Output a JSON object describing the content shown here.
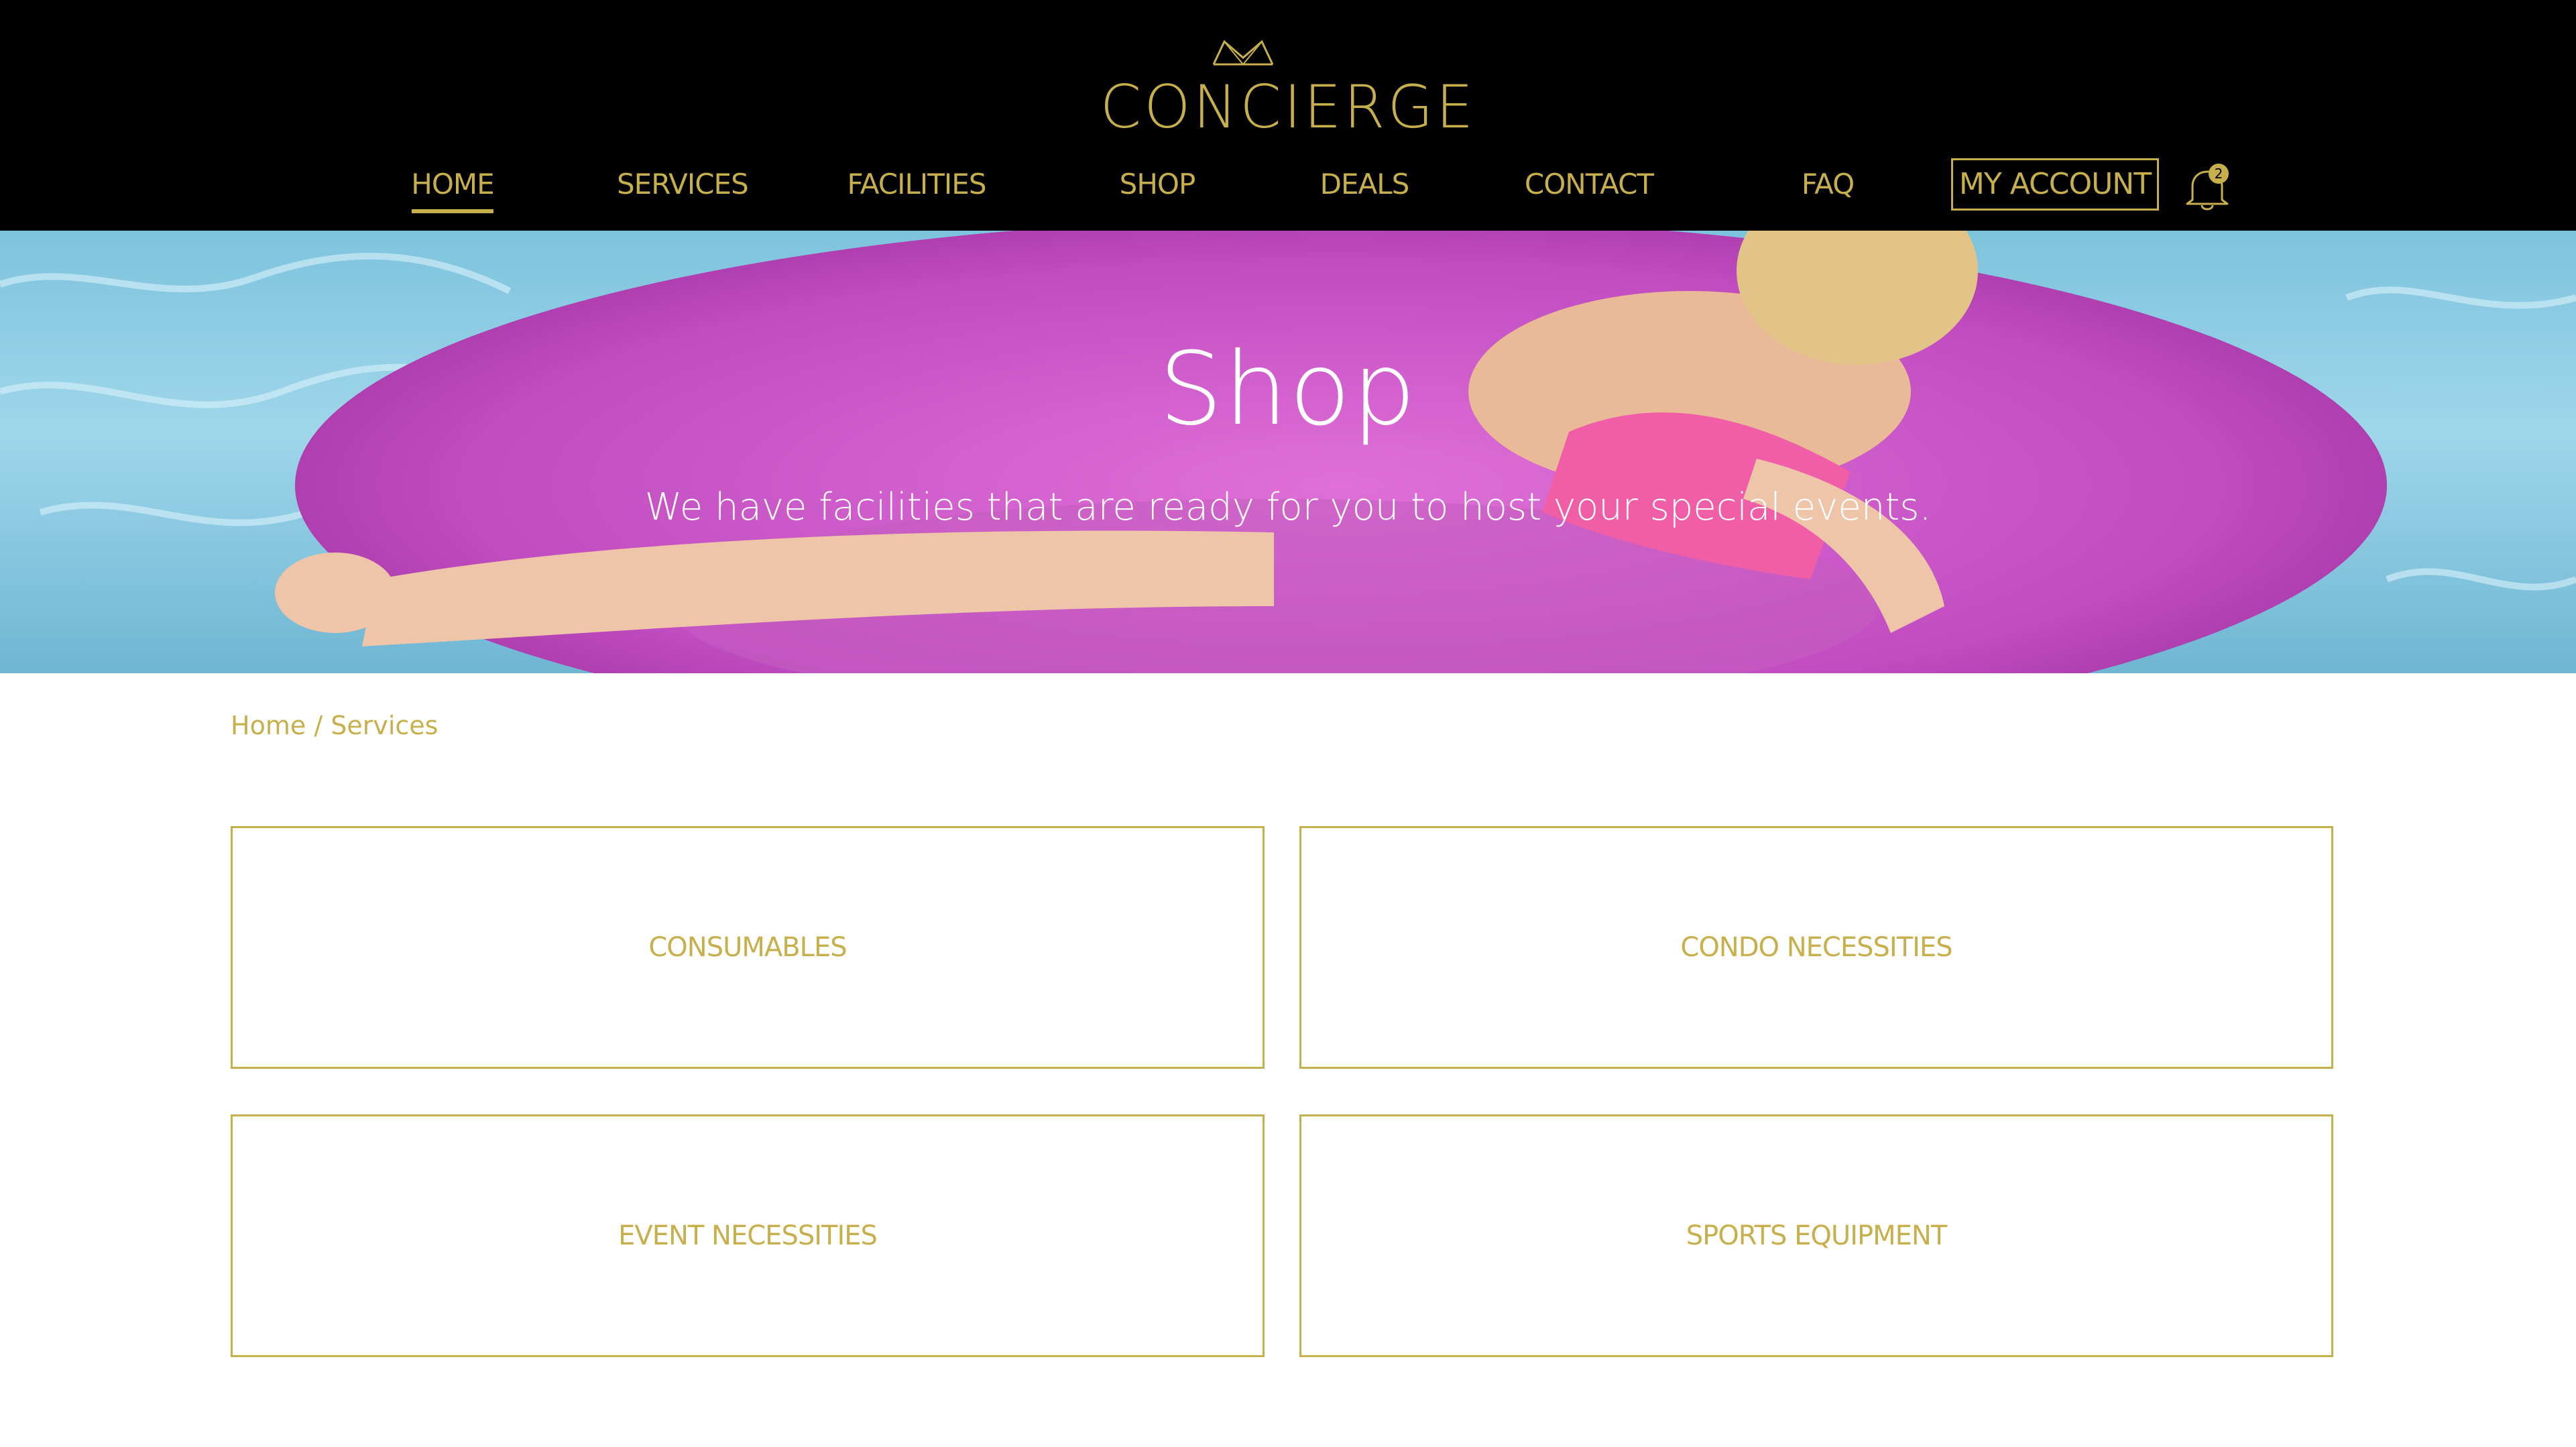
{
  "header": {
    "logo_text": "CONCIERGE",
    "nav": [
      {
        "label": "HOME",
        "active": true
      },
      {
        "label": "SERVICES"
      },
      {
        "label": "FACILITIES"
      },
      {
        "label": "SHOP"
      },
      {
        "label": "DEALS"
      },
      {
        "label": "CONTACT"
      },
      {
        "label": "FAQ"
      }
    ],
    "account_label": "MY ACCOUNT",
    "notification_count": "2"
  },
  "hero": {
    "title": "Shop",
    "subtitle": "We have facilities that are ready for you to host your special events."
  },
  "breadcrumb": {
    "home": "Home",
    "separator": "/",
    "current": "Services"
  },
  "categories": [
    {
      "label": "CONSUMABLES"
    },
    {
      "label": "CONDO NECESSITIES"
    },
    {
      "label": "EVENT NECESSITIES"
    },
    {
      "label": "SPORTS EQUIPMENT"
    }
  ],
  "colors": {
    "accent": "#c7b04c",
    "header_bg": "#000000"
  },
  "icons": [
    "crown-icon",
    "bell-icon"
  ]
}
